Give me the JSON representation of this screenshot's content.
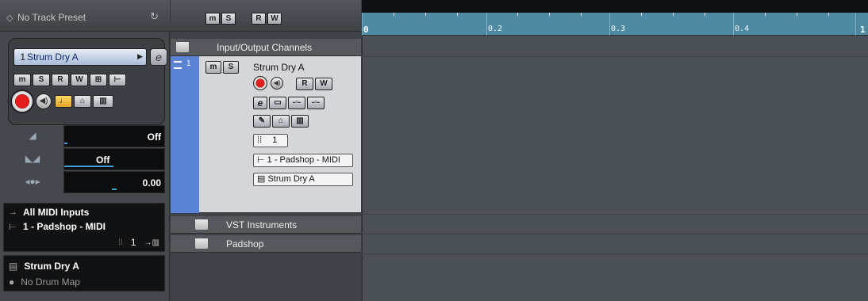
{
  "inspector": {
    "preset": "No Track Preset",
    "track_number": "1",
    "track_name": "Strum Dry A",
    "buttons": {
      "mute": "m",
      "solo": "S",
      "read": "R",
      "write": "W",
      "edit_in_place": "⊞",
      "output": "⊢"
    },
    "params": {
      "volume": "Off",
      "transpose": "Off",
      "pan": "0.00"
    },
    "routing": {
      "input": "All MIDI Inputs",
      "output": "1 - Padshop - MIDI",
      "channel": "1"
    },
    "map": {
      "track_name": "Strum Dry A",
      "drum_map": "No Drum Map"
    }
  },
  "tracklist": {
    "header_buttons": [
      "m",
      "S",
      "R",
      "W"
    ],
    "folders": [
      {
        "name": "Input/Output Channels"
      },
      {
        "name": "VST Instruments"
      },
      {
        "name": "Padshop"
      }
    ],
    "midi_track": {
      "number": "1",
      "name": "Strum Dry A",
      "mute": "m",
      "solo": "S",
      "read": "R",
      "write": "W",
      "channel": "1",
      "output": "1 - Padshop - MIDI",
      "name_field": "Strum Dry A"
    }
  },
  "timeline": {
    "ruler_labels": [
      "0",
      "0.2",
      "0.3",
      "0.4",
      "1"
    ],
    "ruler_color": "#4f8aa3"
  },
  "colors": {
    "track_strip": "#5a83d6",
    "record": "#e61d1d",
    "meter": "#3fa2d6"
  }
}
